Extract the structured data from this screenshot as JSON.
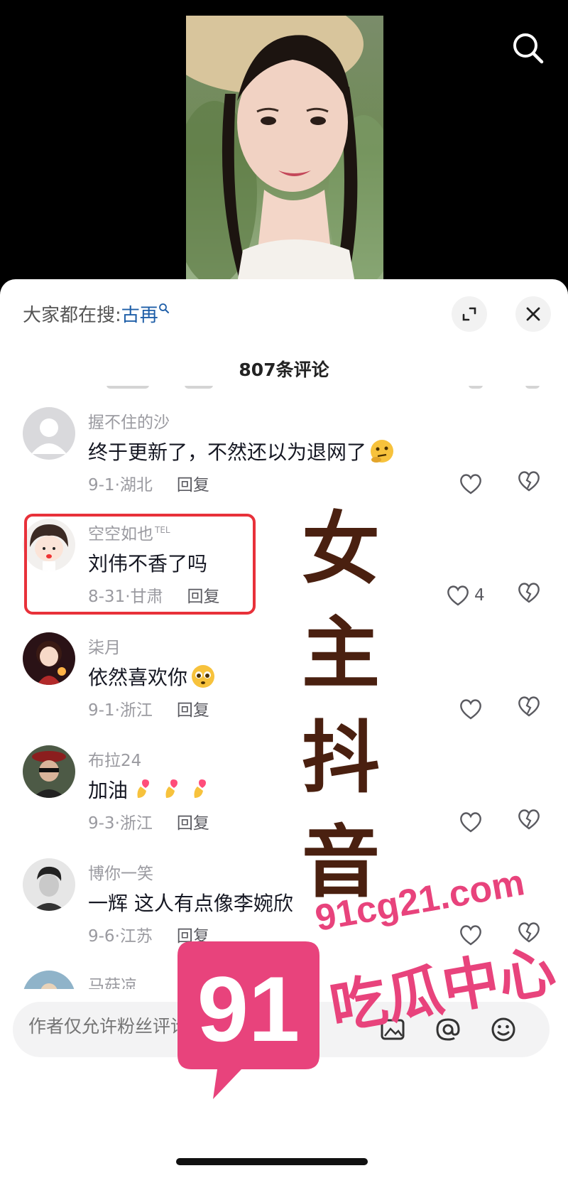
{
  "video": {
    "description_icon": "video-frame"
  },
  "header": {
    "hot_search_prefix": "大家都在搜:",
    "hot_search_keyword": "古再",
    "comment_count": "807条评论"
  },
  "comments": [
    {
      "author": "握不住的沙",
      "badge": "",
      "text": "终于更新了，不然还以为退网了",
      "emoji": "thinking-face",
      "date": "9-1",
      "location": "湖北",
      "reply": "回复",
      "likes": ""
    },
    {
      "author": "空空如也",
      "badge": "TEL",
      "text": "刘伟不香了吗",
      "emoji": "",
      "date": "8-31",
      "location": "甘肃",
      "reply": "回复",
      "likes": "4"
    },
    {
      "author": "柒月",
      "badge": "",
      "text": "依然喜欢你",
      "emoji": "pleading-face",
      "date": "9-1",
      "location": "浙江",
      "reply": "回复",
      "likes": ""
    },
    {
      "author": "布拉24",
      "badge": "",
      "text": "加油",
      "emoji": "finger-heart x3",
      "date": "9-3",
      "location": "浙江",
      "reply": "回复",
      "likes": ""
    },
    {
      "author": "博你一笑",
      "badge": "",
      "text": "一辉  这人有点像李婉欣",
      "emoji": "",
      "date": "9-6",
      "location": "江苏",
      "reply": "回复",
      "likes": ""
    },
    {
      "author": "马菇凉",
      "badge": "",
      "text": "",
      "emoji": "",
      "date": "",
      "location": "",
      "reply": "",
      "likes": ""
    }
  ],
  "meta_separator": "·",
  "input": {
    "placeholder": "作者仅允许粉丝评论"
  },
  "overlay": {
    "chars": [
      "女",
      "主",
      "抖",
      "音"
    ]
  },
  "watermark": {
    "site": "91cg21.com",
    "name": "吃瓜中心",
    "logo_text": "91"
  },
  "colors": {
    "accent_blue": "#1f5fa8",
    "highlight_red": "#e8313a",
    "watermark_pink": "#e8437c",
    "overlay_brown": "#4a2010"
  }
}
